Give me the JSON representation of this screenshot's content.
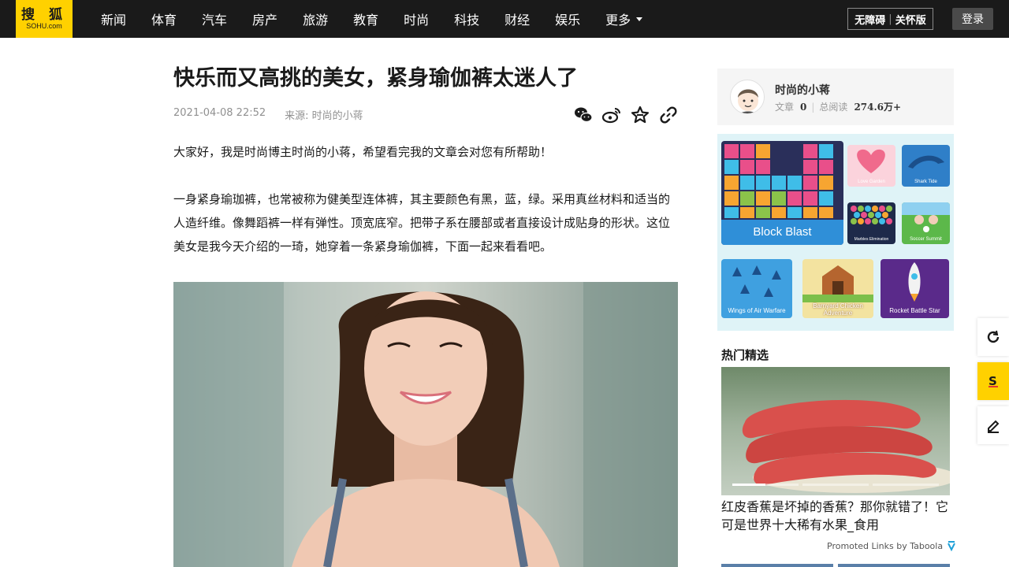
{
  "header": {
    "logo_top": "搜 狐",
    "logo_bottom": "SOHU.com",
    "nav": [
      "新闻",
      "体育",
      "汽车",
      "房产",
      "旅游",
      "教育",
      "时尚",
      "科技",
      "财经",
      "娱乐"
    ],
    "more_label": "更多",
    "accessibility": "无障碍",
    "elder_mode": "关怀版",
    "login_label": "登录"
  },
  "article": {
    "title": "快乐而又高挑的美女，紧身瑜伽裤太迷人了",
    "date": "2021-04-08 22:52",
    "source": "来源: 时尚的小蒋",
    "share_icons": [
      "wechat-icon",
      "weibo-icon",
      "favorite-star-icon",
      "link-icon"
    ],
    "paragraph1": "大家好，我是时尚博主时尚的小蒋，希望看完我的文章会对您有所帮助！",
    "paragraph2": "一身紧身瑜珈裤，也常被称为健美型连体裤，其主要颜色有黑，蓝，绿。采用真丝材料和适当的人造纤维。像舞蹈裤一样有弹性。顶宽底窄。把带子系在腰部或者直接设计成贴身的形状。这位美女是我今天介绍的一琦，她穿着一条紧身瑜伽裤，下面一起来看看吧。"
  },
  "author": {
    "name": "时尚的小蒋",
    "articles_label": "文章",
    "articles_count": "0",
    "reads_label": "总阅读",
    "reads_count": "274.6万+"
  },
  "ad": {
    "games": [
      "Block Blast",
      "Love Garden",
      "Shark Tide",
      "Marbles Elimination",
      "Soccer Summit",
      "Wings of Air Warfare",
      "Barnyard Chicken Adventure",
      "Rocket Battle Star"
    ]
  },
  "hot": {
    "title": "热门精选",
    "caption": "红皮香蕉是坏掉的香蕉？那你就错了！它可是世界十大稀有水果_食用",
    "taboola": "Promoted Links by Taboola"
  },
  "colors": {
    "brand_yellow": "#ffd100",
    "topbar": "#1a1a1a"
  }
}
